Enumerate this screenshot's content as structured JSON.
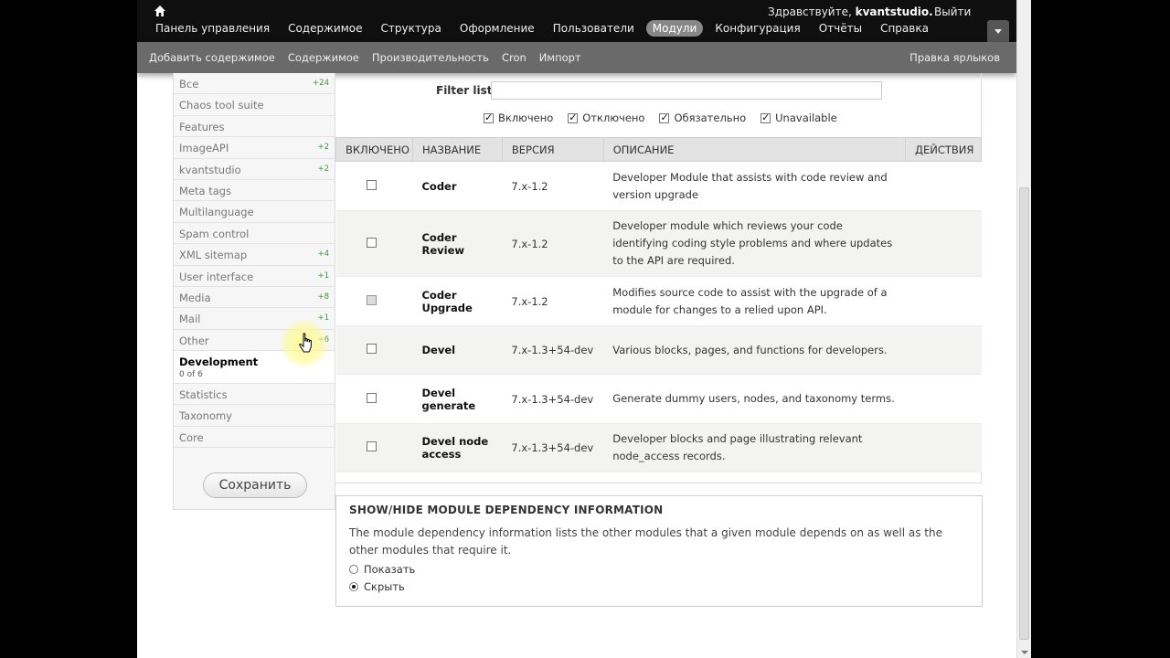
{
  "toolbar": {
    "menu": [
      {
        "label": "Панель управления",
        "active": false
      },
      {
        "label": "Содержимое",
        "active": false
      },
      {
        "label": "Структура",
        "active": false
      },
      {
        "label": "Оформление",
        "active": false
      },
      {
        "label": "Пользователи",
        "active": false
      },
      {
        "label": "Модули",
        "active": true
      },
      {
        "label": "Конфигурация",
        "active": false
      },
      {
        "label": "Отчёты",
        "active": false
      },
      {
        "label": "Справка",
        "active": false
      }
    ],
    "greeting": "Здравствуйте,",
    "username": "kvantstudio.",
    "logout": "Выйти"
  },
  "shortcuts": {
    "items": [
      "Добавить содержимое",
      "Содержимое",
      "Производительность",
      "Cron",
      "Импорт"
    ],
    "edit": "Правка ярлыков"
  },
  "sidebar": {
    "categories": [
      {
        "name": "Все",
        "count": "+24"
      },
      {
        "name": "Chaos tool suite",
        "count": ""
      },
      {
        "name": "Features",
        "count": ""
      },
      {
        "name": "ImageAPI",
        "count": "+2"
      },
      {
        "name": "kvantstudio",
        "count": "+2"
      },
      {
        "name": "Meta tags",
        "count": ""
      },
      {
        "name": "Multilanguage",
        "count": ""
      },
      {
        "name": "Spam control",
        "count": ""
      },
      {
        "name": "XML sitemap",
        "count": "+4"
      },
      {
        "name": "User interface",
        "count": "+1"
      },
      {
        "name": "Media",
        "count": "+8"
      },
      {
        "name": "Mail",
        "count": "+1"
      },
      {
        "name": "Other",
        "count": "+6"
      }
    ],
    "selected": {
      "name": "Development",
      "sub": "0 of 6"
    },
    "categories_after": [
      {
        "name": "Statistics",
        "count": ""
      },
      {
        "name": "Taxonomy",
        "count": ""
      },
      {
        "name": "Core",
        "count": ""
      }
    ],
    "save_label": "Сохранить"
  },
  "filter": {
    "label": "Filter list",
    "value": "",
    "checks": [
      {
        "label": "Включено",
        "checked": true
      },
      {
        "label": "Отключено",
        "checked": true
      },
      {
        "label": "Обязательно",
        "checked": true
      },
      {
        "label": "Unavailable",
        "checked": true
      }
    ]
  },
  "table": {
    "headers": [
      "Включено",
      "Название",
      "Версия",
      "Описание",
      "Действия"
    ],
    "rows": [
      {
        "name": "Coder",
        "version": "7.x-1.2",
        "description": "Developer Module that assists with code review and version upgrade",
        "enabled": false,
        "disabled": false
      },
      {
        "name": "Coder Review",
        "version": "7.x-1.2",
        "description": "Developer module which reviews your code identifying coding style problems and where updates to the API are required.",
        "enabled": false,
        "disabled": false
      },
      {
        "name": "Coder Upgrade",
        "version": "7.x-1.2",
        "description": "Modifies source code to assist with the upgrade of a module for changes to a relied upon API.",
        "enabled": false,
        "disabled": true
      },
      {
        "name": "Devel",
        "version": "7.x-1.3+54-dev",
        "description": "Various blocks, pages, and functions for developers.",
        "enabled": false,
        "disabled": false
      },
      {
        "name": "Devel generate",
        "version": "7.x-1.3+54-dev",
        "description": "Generate dummy users, nodes, and taxonomy terms.",
        "enabled": false,
        "disabled": false
      },
      {
        "name": "Devel node access",
        "version": "7.x-1.3+54-dev",
        "description": "Developer blocks and page illustrating relevant node_access records.",
        "enabled": false,
        "disabled": false
      }
    ]
  },
  "dependency": {
    "title": "SHOW/HIDE MODULE DEPENDENCY INFORMATION",
    "text": "The module dependency information lists the other modules that a given module depends on as well as the other modules that require it.",
    "options": [
      {
        "label": "Показать",
        "selected": false
      },
      {
        "label": "Скрыть",
        "selected": true
      }
    ]
  },
  "icons": {
    "home": "home-icon",
    "toggle": "chevron-down-icon",
    "cursor": "hand-pointer-icon"
  }
}
